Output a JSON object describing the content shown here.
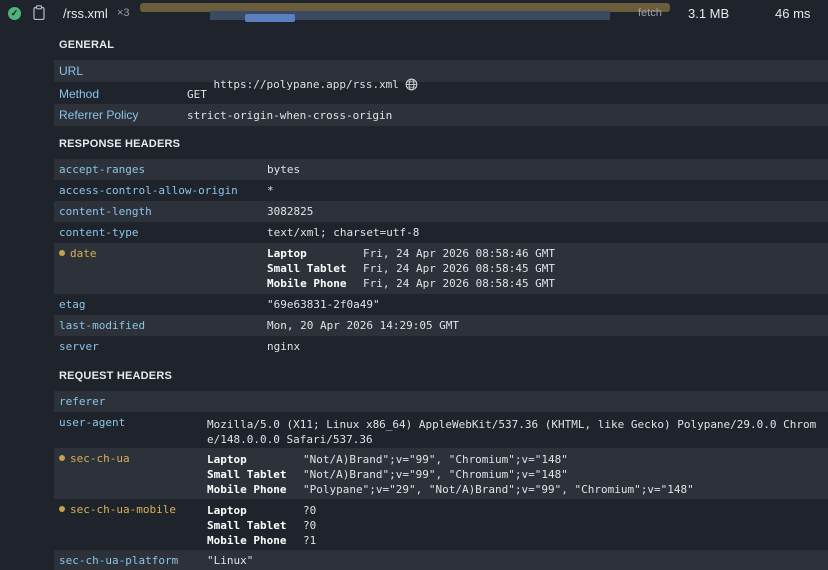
{
  "request": {
    "name": "/rss.xml",
    "count": "×3",
    "type": "fetch",
    "size": "3.1 MB",
    "time": "46 ms"
  },
  "general": {
    "title": "GENERAL",
    "url_label": "URL",
    "url": "https://polypane.app/rss.xml",
    "method_label": "Method",
    "method": "GET",
    "referrer_label": "Referrer Policy",
    "referrer": "strict-origin-when-cross-origin"
  },
  "response": {
    "title": "RESPONSE HEADERS",
    "accept_ranges": {
      "key": "accept-ranges",
      "value": "bytes"
    },
    "acao": {
      "key": "access-control-allow-origin",
      "value": "*"
    },
    "content_length": {
      "key": "content-length",
      "value": "3082825"
    },
    "content_type": {
      "key": "content-type",
      "value": "text/xml; charset=utf-8"
    },
    "date": {
      "key": "date",
      "devices": [
        {
          "device": "Laptop",
          "value": "Fri, 24 Apr 2026 08:58:46 GMT"
        },
        {
          "device": "Small Tablet",
          "value": "Fri, 24 Apr 2026 08:58:45 GMT"
        },
        {
          "device": "Mobile Phone",
          "value": "Fri, 24 Apr 2026 08:58:45 GMT"
        }
      ]
    },
    "etag": {
      "key": "etag",
      "value": "\"69e63831-2f0a49\""
    },
    "last_modified": {
      "key": "last-modified",
      "value": "Mon, 20 Apr 2026 14:29:05 GMT"
    },
    "server": {
      "key": "server",
      "value": "nginx"
    }
  },
  "requestHeaders": {
    "title": "REQUEST HEADERS",
    "referer": {
      "key": "referer"
    },
    "user_agent": {
      "key": "user-agent",
      "value": "Mozilla/5.0 (X11; Linux x86_64) AppleWebKit/537.36 (KHTML, like Gecko) Polypane/29.0.0 Chrome/148.0.0.0 Safari/537.36"
    },
    "sec_ch_ua": {
      "key": "sec-ch-ua",
      "devices": [
        {
          "device": "Laptop",
          "value": "\"Not/A)Brand\";v=\"99\", \"Chromium\";v=\"148\""
        },
        {
          "device": "Small Tablet",
          "value": "\"Not/A)Brand\";v=\"99\", \"Chromium\";v=\"148\""
        },
        {
          "device": "Mobile Phone",
          "value": "\"Polypane\";v=\"29\", \"Not/A)Brand\";v=\"99\", \"Chromium\";v=\"148\""
        }
      ]
    },
    "sec_ch_ua_mobile": {
      "key": "sec-ch-ua-mobile",
      "devices": [
        {
          "device": "Laptop",
          "value": "?0"
        },
        {
          "device": "Small Tablet",
          "value": "?0"
        },
        {
          "device": "Mobile Phone",
          "value": "?1"
        }
      ]
    },
    "sec_ch_ua_platform": {
      "key": "sec-ch-ua-platform",
      "value": "\"Linux\""
    }
  },
  "icons": {
    "status": "check-circle-icon",
    "copy": "clipboard-icon",
    "url": "globe-icon"
  },
  "colors": {
    "background": "#1f232b",
    "row_alt": "#2c313a",
    "key": "#8cc4e8",
    "diff_key": "#d5b353",
    "success": "#4fb37a"
  }
}
